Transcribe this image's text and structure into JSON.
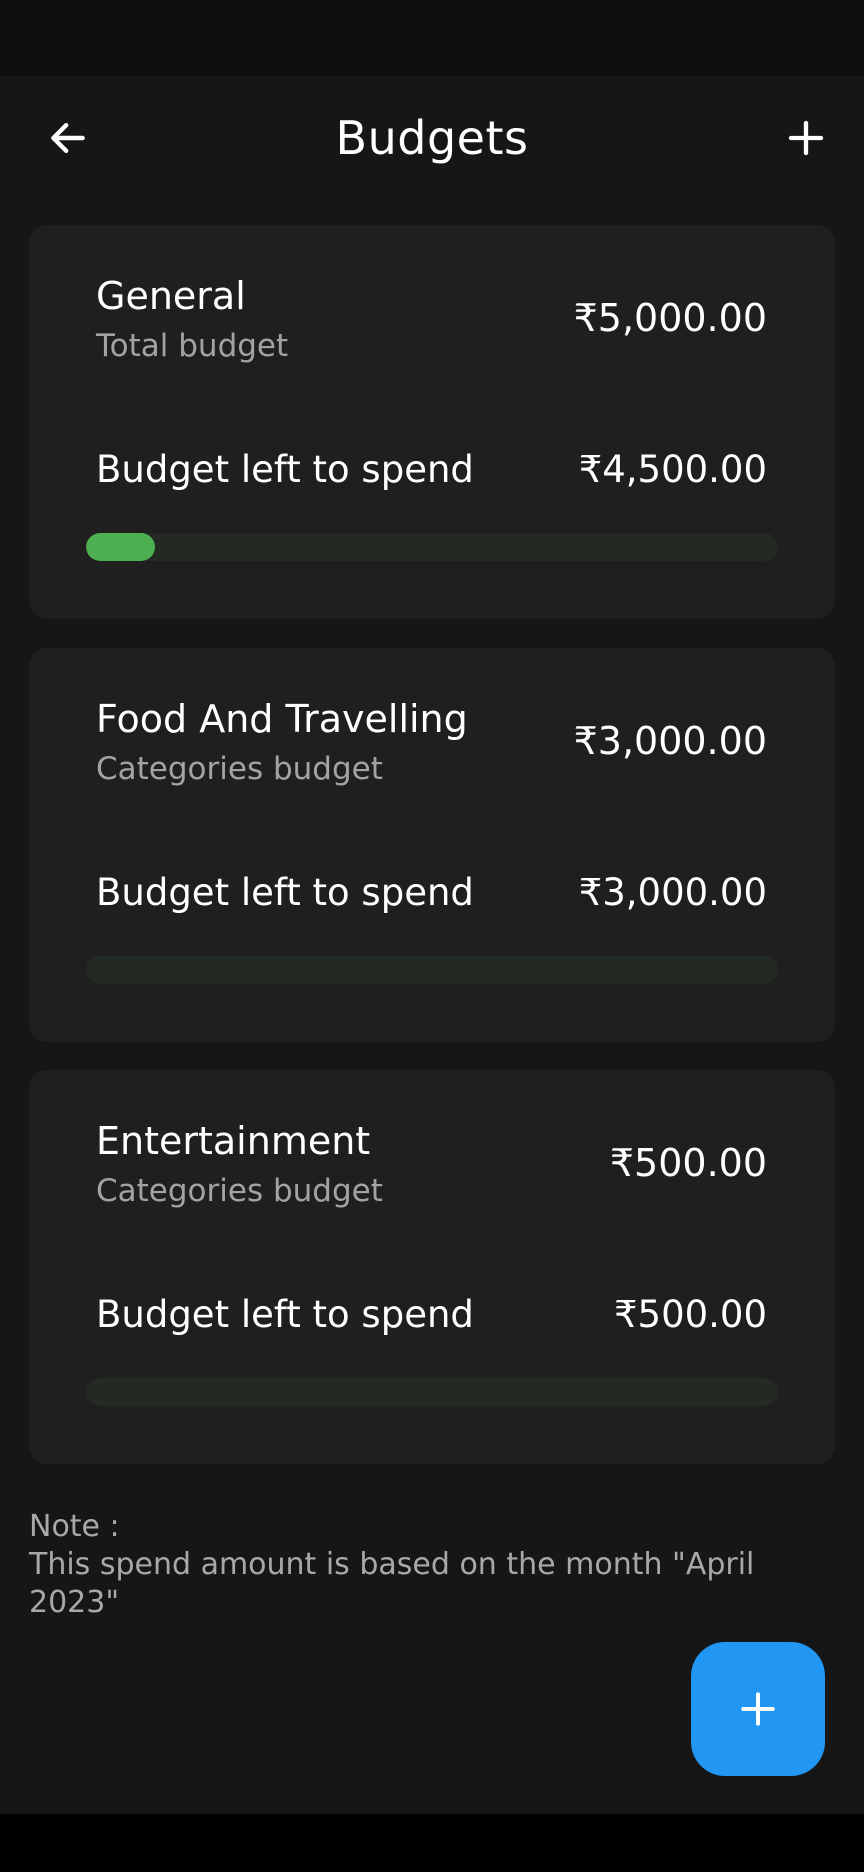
{
  "header": {
    "title": "Budgets",
    "back_icon": "arrow-left-icon",
    "add_icon": "plus-icon"
  },
  "budgets": [
    {
      "name": "General",
      "type": "Total budget",
      "amount": "₹5,000.00",
      "left_label": "Budget left to spend",
      "left_amount": "₹4,500.00",
      "spent_fraction": 0.1
    },
    {
      "name": "Food And Travelling",
      "type": "Categories budget",
      "amount": "₹3,000.00",
      "left_label": "Budget left to spend",
      "left_amount": "₹3,000.00",
      "spent_fraction": 0
    },
    {
      "name": "Entertainment",
      "type": "Categories budget",
      "amount": "₹500.00",
      "left_label": "Budget left to spend",
      "left_amount": "₹500.00",
      "spent_fraction": 0
    }
  ],
  "note": {
    "label": "Note :",
    "text": "This spend amount is based on the month \"April 2023\""
  },
  "fab": {
    "icon": "plus-icon"
  },
  "colors": {
    "accent": "#2196f3",
    "progress": "#4caf50",
    "card_bg": "#1f1f1f",
    "background": "#161616"
  }
}
